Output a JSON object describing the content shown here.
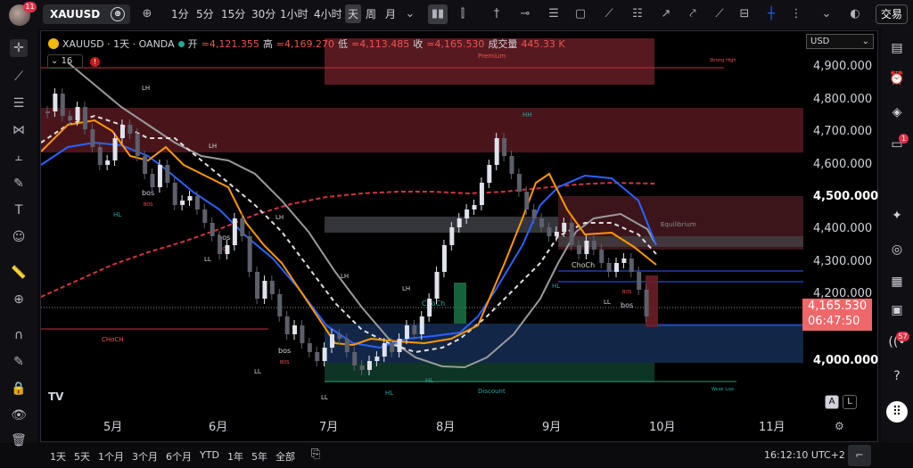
{
  "top": {
    "notifications": "11",
    "symbol": "XAUUSD",
    "intervals": [
      "1分",
      "5分",
      "15分",
      "30分",
      "1小时",
      "4小时",
      "天",
      "周",
      "月"
    ],
    "active_interval": "天",
    "trade_label": "交易"
  },
  "legend": {
    "title": "XAUUSD · 1天 · OANDA",
    "open_label": "开",
    "open": "=4,121.355",
    "high_label": "高",
    "high": "=4,169.270",
    "low_label": "低",
    "low": "=4,113.485",
    "close_label": "收",
    "close": "=4,165.530",
    "volume_label": "成交量",
    "volume": "445.33 K",
    "interval_count": "16",
    "alert": "!"
  },
  "price_axis": {
    "currency": "USD",
    "ticks": [
      "4,900.000",
      "4,800.000",
      "4,700.000",
      "4,600.000",
      "4,500.000",
      "4,400.000",
      "4,300.000",
      "4,200.000",
      "4,000.000"
    ],
    "current_price": "4,165.530",
    "countdown": "06:47:50"
  },
  "time_axis": {
    "months": [
      "5月",
      "6月",
      "7月",
      "8月",
      "9月",
      "10月",
      "11月"
    ]
  },
  "annotations": {
    "premium": "Premium",
    "strong_high": "Strong High",
    "equilibrium": "Equilibrium",
    "discount": "Discount",
    "weak_low": "Weak Low",
    "choch": "CHoCH",
    "choch2": "ChoCh",
    "bos": "bos",
    "BOS": "BOS",
    "LH": "LH",
    "LL": "LL",
    "HL": "HL",
    "HH": "HH"
  },
  "bottom": {
    "ranges": [
      "1天",
      "5天",
      "1个月",
      "3个月",
      "6个月",
      "YTD",
      "1年",
      "5年",
      "全部"
    ],
    "clock": "16:12:10 UTC+2",
    "auto": "A",
    "log": "L"
  },
  "colors": {
    "up": "#e0e3eb",
    "down": "#5d606b",
    "orange": "#ff9800",
    "blue": "#2962ff",
    "price_tag": "#f0676a",
    "premium_zone": "#6b1f27",
    "discount_zone": "#13294b"
  }
}
